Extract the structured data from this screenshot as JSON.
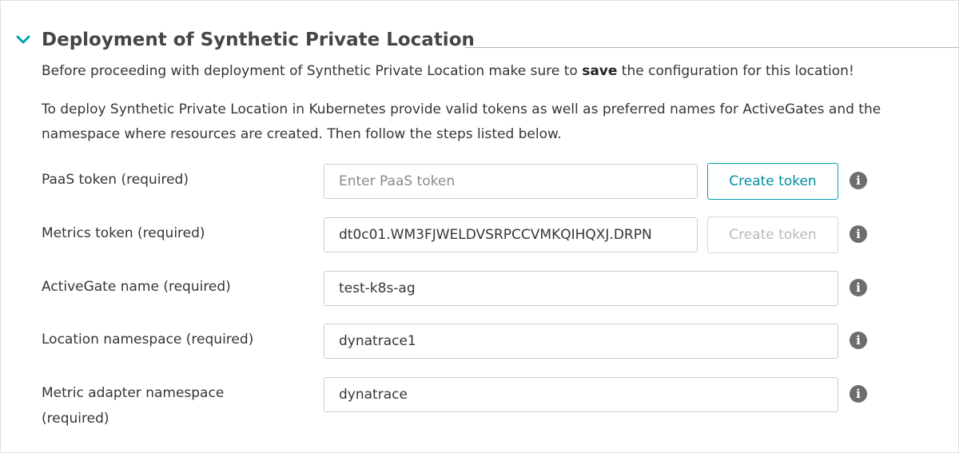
{
  "section": {
    "title": "Deployment of Synthetic Private Location",
    "expanded_icon": "chevron-down-icon",
    "accent_color": "#00a1b2"
  },
  "intro": {
    "prefix": "Before proceeding with deployment of Synthetic Private Location make sure to ",
    "bold": "save",
    "suffix": " the configuration for this location!"
  },
  "description": "To deploy Synthetic Private Location in Kubernetes provide valid tokens as well as preferred names for ActiveGates and the namespace where resources are created. Then follow the steps listed below.",
  "fields": {
    "paas": {
      "label": "PaaS token (required)",
      "value": "",
      "placeholder": "Enter PaaS token",
      "button": "Create token",
      "button_state": "enabled"
    },
    "metrics": {
      "label": "Metrics token (required)",
      "value": "dt0c01.WM3FJWELDVSRPCCVMKQIHQXJ.DRPN",
      "button": "Create token",
      "button_state": "disabled"
    },
    "activegate": {
      "label": "ActiveGate name (required)",
      "value": "test-k8s-ag"
    },
    "location_ns": {
      "label": "Location namespace (required)",
      "value": "dynatrace1"
    },
    "adapter_ns": {
      "label_line1": "Metric adapter namespace",
      "label_line2": "(required)",
      "value": "dynatrace"
    }
  },
  "info_icon": "info-icon"
}
